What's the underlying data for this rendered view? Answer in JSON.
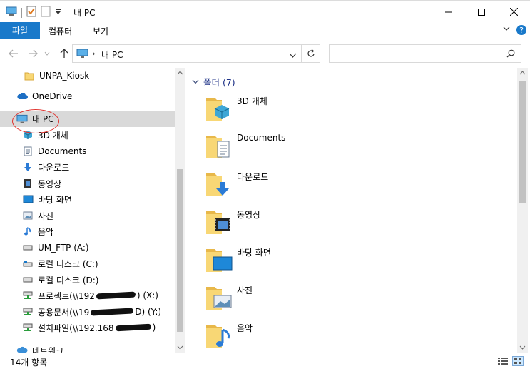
{
  "window": {
    "title": "내 PC"
  },
  "ribbon": {
    "tabs": [
      "파일",
      "컴퓨터",
      "보기"
    ]
  },
  "address": {
    "path_crumb": "내 PC",
    "separator": "›",
    "search_placeholder": ""
  },
  "nav": {
    "items": [
      {
        "label": "UNPA_Kiosk",
        "icon": "folder-icon"
      },
      {
        "label": "OneDrive",
        "icon": "cloud-icon"
      },
      {
        "label": "내 PC",
        "icon": "computer-icon",
        "selected": true
      },
      {
        "label": "3D 개체",
        "icon": "3d-objects-icon"
      },
      {
        "label": "Documents",
        "icon": "document-icon"
      },
      {
        "label": "다운로드",
        "icon": "download-arrow-icon"
      },
      {
        "label": "동영상",
        "icon": "video-icon"
      },
      {
        "label": "바탕 화면",
        "icon": "desktop-icon"
      },
      {
        "label": "사진",
        "icon": "picture-icon"
      },
      {
        "label": "음악",
        "icon": "music-note-icon"
      },
      {
        "label": "UM_FTP (A:)",
        "icon": "drive-icon"
      },
      {
        "label": "로컬 디스크 (C:)",
        "icon": "drive-icon"
      },
      {
        "label": "로컬 디스크 (D:)",
        "icon": "drive-icon"
      },
      {
        "label": "프로젝트(\\\\192",
        "suffix": ") (X:)",
        "icon": "network-drive-icon"
      },
      {
        "label": "공용문서(\\\\19",
        "suffix": "D) (Y:)",
        "icon": "network-drive-icon"
      },
      {
        "label": "설치파일(\\\\192.168",
        "suffix": ")",
        "icon": "network-drive-icon"
      },
      {
        "label": "네트워크",
        "icon": "network-icon"
      }
    ]
  },
  "content": {
    "group_label": "폴더 (7)",
    "folders": [
      {
        "name": "3D 개체",
        "overlay": "3d-objects-icon"
      },
      {
        "name": "Documents",
        "overlay": "document-icon"
      },
      {
        "name": "다운로드",
        "overlay": "download-arrow-icon"
      },
      {
        "name": "동영상",
        "overlay": "video-icon"
      },
      {
        "name": "바탕 화면",
        "overlay": "desktop-icon"
      },
      {
        "name": "사진",
        "overlay": "picture-icon"
      },
      {
        "name": "음악",
        "overlay": "music-note-icon"
      }
    ]
  },
  "status": {
    "item_count": "14개 항목"
  },
  "colors": {
    "accent": "#1979ca",
    "folder": "#f8d775",
    "folder_dark": "#e8b84a",
    "selected": "#d9d9d9",
    "annotation": "#e0302c"
  }
}
